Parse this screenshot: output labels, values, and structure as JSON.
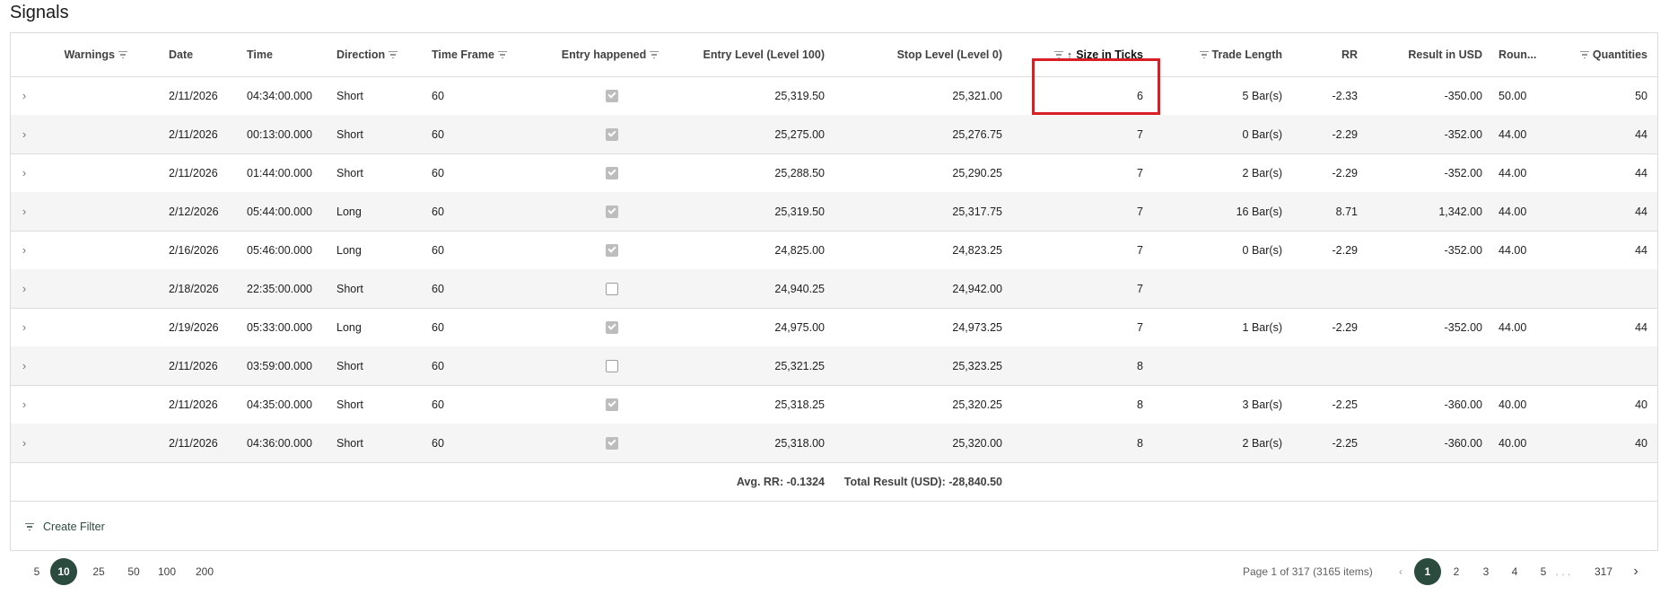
{
  "page_title": "Signals",
  "columns": {
    "warnings": "Warnings",
    "date": "Date",
    "time": "Time",
    "direction": "Direction",
    "time_frame": "Time Frame",
    "entry_happened": "Entry happened",
    "entry_level": "Entry Level (Level 100)",
    "stop_level": "Stop Level (Level 0)",
    "size_in_ticks": "Size in Ticks",
    "trade_length": "Trade Length",
    "rr": "RR",
    "result_usd": "Result in USD",
    "rounded": "Roun...",
    "quantities": "Quantities"
  },
  "rows": [
    {
      "date": "2/11/2026",
      "time": "04:34:00.000",
      "direction": "Short",
      "tf": "60",
      "entry": true,
      "entry_level": "25,319.50",
      "stop_level": "25,321.00",
      "ticks": "6",
      "length": "5 Bar(s)",
      "rr": "-2.33",
      "result": "-350.00",
      "rounded": "50.00",
      "qty": "50"
    },
    {
      "date": "2/11/2026",
      "time": "00:13:00.000",
      "direction": "Short",
      "tf": "60",
      "entry": true,
      "entry_level": "25,275.00",
      "stop_level": "25,276.75",
      "ticks": "7",
      "length": "0 Bar(s)",
      "rr": "-2.29",
      "result": "-352.00",
      "rounded": "44.00",
      "qty": "44"
    },
    {
      "date": "2/11/2026",
      "time": "01:44:00.000",
      "direction": "Short",
      "tf": "60",
      "entry": true,
      "entry_level": "25,288.50",
      "stop_level": "25,290.25",
      "ticks": "7",
      "length": "2 Bar(s)",
      "rr": "-2.29",
      "result": "-352.00",
      "rounded": "44.00",
      "qty": "44"
    },
    {
      "date": "2/12/2026",
      "time": "05:44:00.000",
      "direction": "Long",
      "tf": "60",
      "entry": true,
      "entry_level": "25,319.50",
      "stop_level": "25,317.75",
      "ticks": "7",
      "length": "16 Bar(s)",
      "rr": "8.71",
      "result": "1,342.00",
      "rounded": "44.00",
      "qty": "44"
    },
    {
      "date": "2/16/2026",
      "time": "05:46:00.000",
      "direction": "Long",
      "tf": "60",
      "entry": true,
      "entry_level": "24,825.00",
      "stop_level": "24,823.25",
      "ticks": "7",
      "length": "0 Bar(s)",
      "rr": "-2.29",
      "result": "-352.00",
      "rounded": "44.00",
      "qty": "44"
    },
    {
      "date": "2/18/2026",
      "time": "22:35:00.000",
      "direction": "Short",
      "tf": "60",
      "entry": false,
      "entry_level": "24,940.25",
      "stop_level": "24,942.00",
      "ticks": "7",
      "length": "",
      "rr": "",
      "result": "",
      "rounded": "",
      "qty": ""
    },
    {
      "date": "2/19/2026",
      "time": "05:33:00.000",
      "direction": "Long",
      "tf": "60",
      "entry": true,
      "entry_level": "24,975.00",
      "stop_level": "24,973.25",
      "ticks": "7",
      "length": "1 Bar(s)",
      "rr": "-2.29",
      "result": "-352.00",
      "rounded": "44.00",
      "qty": "44"
    },
    {
      "date": "2/11/2026",
      "time": "03:59:00.000",
      "direction": "Short",
      "tf": "60",
      "entry": false,
      "entry_level": "25,321.25",
      "stop_level": "25,323.25",
      "ticks": "8",
      "length": "",
      "rr": "",
      "result": "",
      "rounded": "",
      "qty": ""
    },
    {
      "date": "2/11/2026",
      "time": "04:35:00.000",
      "direction": "Short",
      "tf": "60",
      "entry": true,
      "entry_level": "25,318.25",
      "stop_level": "25,320.25",
      "ticks": "8",
      "length": "3 Bar(s)",
      "rr": "-2.25",
      "result": "-360.00",
      "rounded": "40.00",
      "qty": "40"
    },
    {
      "date": "2/11/2026",
      "time": "04:36:00.000",
      "direction": "Short",
      "tf": "60",
      "entry": true,
      "entry_level": "25,318.00",
      "stop_level": "25,320.00",
      "ticks": "8",
      "length": "2 Bar(s)",
      "rr": "-2.25",
      "result": "-360.00",
      "rounded": "40.00",
      "qty": "40"
    }
  ],
  "summary": {
    "avg_rr": "Avg. RR: -0.1324",
    "total_result": "Total Result (USD): -28,840.50"
  },
  "create_filter_label": "Create Filter",
  "page_sizes": [
    "5",
    "10",
    "25",
    "50",
    "100",
    "200"
  ],
  "selected_page_size": "10",
  "pager": {
    "info": "Page 1 of 317 (3165 items)",
    "pages": [
      "1",
      "2",
      "3",
      "4",
      "5"
    ],
    "ellipsis": ". . .",
    "last_page": "317",
    "current_page": "1"
  },
  "colors": {
    "accent": "#2a4b3d",
    "highlight_box": "#d81f26",
    "alt_row": "#f5f5f5"
  },
  "icons": {
    "row_expand": "chevron-right-icon",
    "column_filter": "filter-icon",
    "sort": "sort-ascending-icon",
    "prev_page": "chevron-left-icon",
    "next_page": "chevron-right-icon"
  }
}
